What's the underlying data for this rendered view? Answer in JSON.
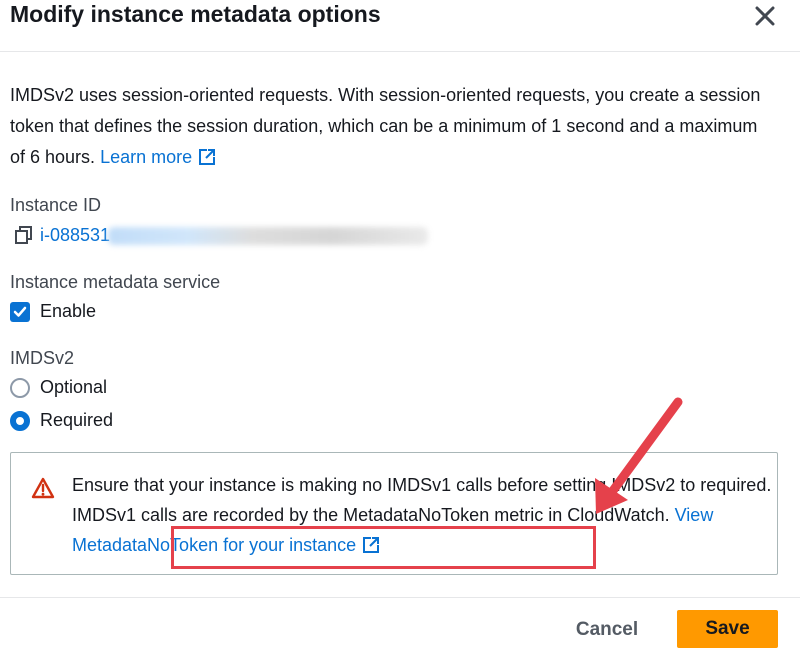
{
  "modal": {
    "title": "Modify instance metadata options",
    "description": "IMDSv2 uses session-oriented requests. With session-oriented requests, you create a session token that defines the session duration, which can be a minimum of 1 second and a maximum of 6 hours.",
    "learn_more": "Learn more"
  },
  "instance": {
    "label": "Instance ID",
    "id_visible": "i-088531"
  },
  "metadata_service": {
    "label": "Instance metadata service",
    "enable_label": "Enable",
    "enabled": true
  },
  "imdsv2": {
    "label": "IMDSv2",
    "options": [
      {
        "label": "Optional",
        "selected": false
      },
      {
        "label": "Required",
        "selected": true
      }
    ]
  },
  "alert": {
    "text": "Ensure that your instance is making no IMDSv1 calls before setting IMDSv2 to required. IMDSv1 calls are recorded by the MetadataNoToken metric in CloudWatch.",
    "link": "View MetadataNoToken for your instance"
  },
  "footer": {
    "cancel_label": "Cancel",
    "save_label": "Save"
  },
  "colors": {
    "link": "#0972d3",
    "primary_button": "#ff9900",
    "annotation": "#e5414b",
    "warning": "#d13212"
  },
  "icons": {
    "close": "close-icon",
    "external": "external-link-icon",
    "copy": "copy-icon",
    "warning": "warning-icon",
    "check": "check-icon"
  }
}
